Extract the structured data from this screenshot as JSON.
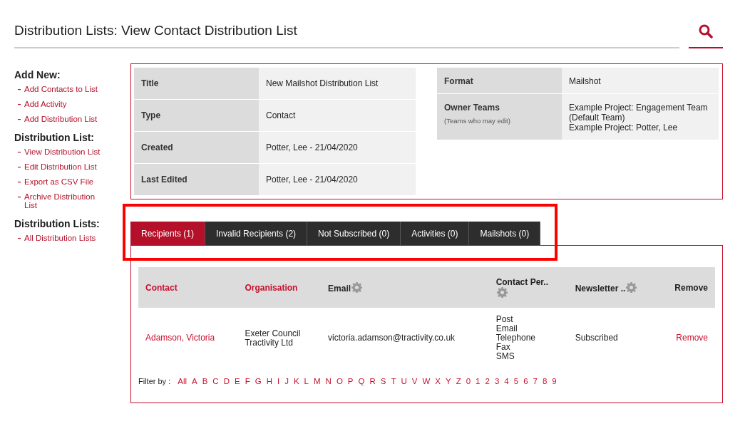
{
  "page_title": "Distribution Lists: View Contact Distribution List",
  "sidebar": [
    {
      "heading": "Add New:",
      "links": [
        "Add Contacts to List",
        "Add Activity",
        "Add Distribution List"
      ]
    },
    {
      "heading": "Distribution List:",
      "links": [
        "View Distribution List",
        "Edit Distribution List",
        "Export as CSV File",
        "Archive Distribution List"
      ]
    },
    {
      "heading": "Distribution Lists:",
      "links": [
        "All Distribution Lists"
      ]
    }
  ],
  "details_left": [
    {
      "label": "Title",
      "value": "New Mailshot Distribution List"
    },
    {
      "label": "Type",
      "value": "Contact"
    },
    {
      "label": "Created",
      "value": "Potter, Lee - 21/04/2020"
    },
    {
      "label": "Last Edited",
      "value": "Potter, Lee - 21/04/2020"
    }
  ],
  "details_right": [
    {
      "label": "Format",
      "value": [
        "Mailshot"
      ]
    },
    {
      "label": "Owner Teams",
      "note": "(Teams who may edit)",
      "value": [
        "Example Project: Engagement Team (Default Team)",
        "Example Project: Potter, Lee"
      ]
    }
  ],
  "tabs": [
    {
      "label": "Recipients (1)",
      "selected": true
    },
    {
      "label": "Invalid Recipients (2)",
      "selected": false
    },
    {
      "label": "Not Subscribed (0)",
      "selected": false
    },
    {
      "label": "Activities (0)",
      "selected": false
    },
    {
      "label": "Mailshots (0)",
      "selected": false
    }
  ],
  "table": {
    "columns": [
      {
        "label": "Contact",
        "kind": "sortable"
      },
      {
        "label": "Organisation",
        "kind": "sortable"
      },
      {
        "label": "Email",
        "kind": "settings"
      },
      {
        "label": "Contact Per..",
        "kind": "settings"
      },
      {
        "label": "Newsletter ..",
        "kind": "settings"
      },
      {
        "label": "Remove",
        "kind": "plain"
      }
    ],
    "rows": [
      {
        "contact": "Adamson, Victoria",
        "organisation": [
          "Exeter Council",
          "Tractivity Ltd"
        ],
        "email": "victoria.adamson@tractivity.co.uk",
        "contact_preferences": [
          "Post",
          "Email",
          "Telephone",
          "Fax",
          "SMS"
        ],
        "newsletter": "Subscribed",
        "remove": "Remove"
      }
    ]
  },
  "filter": {
    "label": "Filter by :",
    "options": [
      "All",
      "A",
      "B",
      "C",
      "D",
      "E",
      "F",
      "G",
      "H",
      "I",
      "J",
      "K",
      "L",
      "M",
      "N",
      "O",
      "P",
      "Q",
      "R",
      "S",
      "T",
      "U",
      "V",
      "W",
      "X",
      "Y",
      "Z",
      "0",
      "1",
      "2",
      "3",
      "4",
      "5",
      "6",
      "7",
      "8",
      "9"
    ]
  },
  "highlight_box": true
}
